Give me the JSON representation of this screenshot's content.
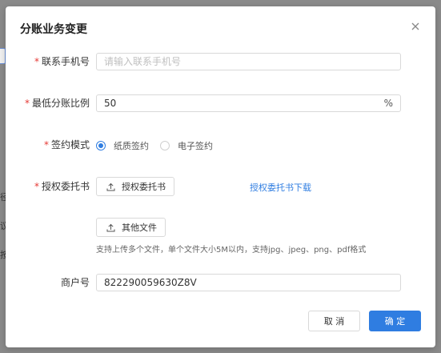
{
  "background": {
    "fragments": [
      "径",
      "议",
      "按"
    ]
  },
  "dialog": {
    "title": "分账业务变更"
  },
  "form": {
    "phone": {
      "label": "联系手机号",
      "required_mark": "*",
      "placeholder": "请输入联系手机号",
      "value": ""
    },
    "min_ratio": {
      "label": "最低分账比例",
      "required_mark": "*",
      "value": "50",
      "suffix": "%"
    },
    "sign_mode": {
      "label": "签约模式",
      "required_mark": "*",
      "options": [
        {
          "label": "纸质签约",
          "checked": true
        },
        {
          "label": "电子签约",
          "checked": false
        }
      ]
    },
    "authorization": {
      "label": "授权委托书",
      "required_mark": "*",
      "upload_label": "授权委托书",
      "download_link": "授权委托书下载"
    },
    "other_files": {
      "upload_label": "其他文件",
      "hint": "支持上传多个文件，单个文件大小5M以内，支持jpg、jpeg、png、pdf格式"
    },
    "merchant_no": {
      "label": "商户号",
      "value": "822290059630Z8V"
    }
  },
  "footer": {
    "cancel_label": "取 消",
    "ok_label": "确 定"
  },
  "colors": {
    "primary": "#2f7de1",
    "required": "#e53935"
  }
}
